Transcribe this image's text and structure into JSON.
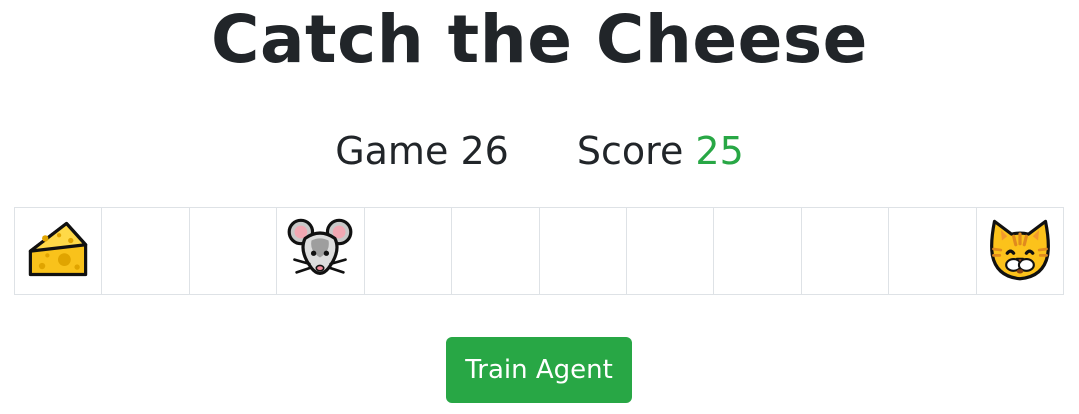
{
  "title": "Catch the Cheese",
  "stats": {
    "game_label": "Game",
    "game_value": "26",
    "score_label": "Score",
    "score_value": "25"
  },
  "board": {
    "cell_count": 12,
    "pieces": [
      {
        "cell": 0,
        "icon": "cheese-icon"
      },
      {
        "cell": 3,
        "icon": "mouse-icon"
      },
      {
        "cell": 11,
        "icon": "cat-icon"
      }
    ]
  },
  "actions": {
    "train_label": "Train Agent"
  },
  "colors": {
    "score": "#28a745",
    "button": "#28a745",
    "cell_border": "#dee2e6",
    "text": "#212529"
  }
}
